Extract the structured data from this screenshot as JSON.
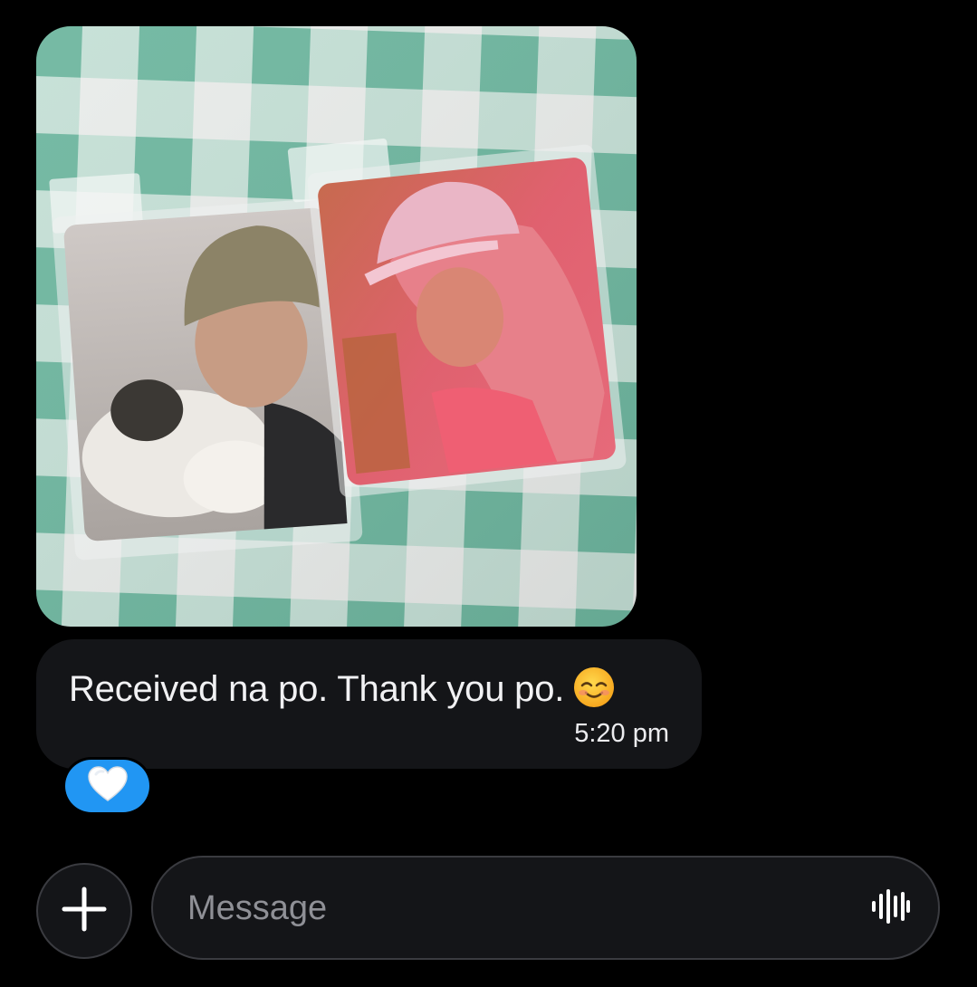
{
  "conversation": {
    "photo_message": {
      "alt": "Two photocards in plastic sleeves on a mint green gingham tablecloth"
    },
    "text_message": {
      "text": "Received na po. Thank you po.",
      "emoji_icon": "smiling-face-icon",
      "time": "5:20 pm"
    },
    "reaction": {
      "icon": "white-heart-icon",
      "color": "#2196f3"
    }
  },
  "composer": {
    "add_icon": "plus-icon",
    "placeholder": "Message",
    "voice_icon": "audio-waveform-icon"
  },
  "colors": {
    "background": "#000000",
    "bubble": "#141518",
    "reaction": "#2196f3",
    "placeholder": "#8f9096"
  }
}
